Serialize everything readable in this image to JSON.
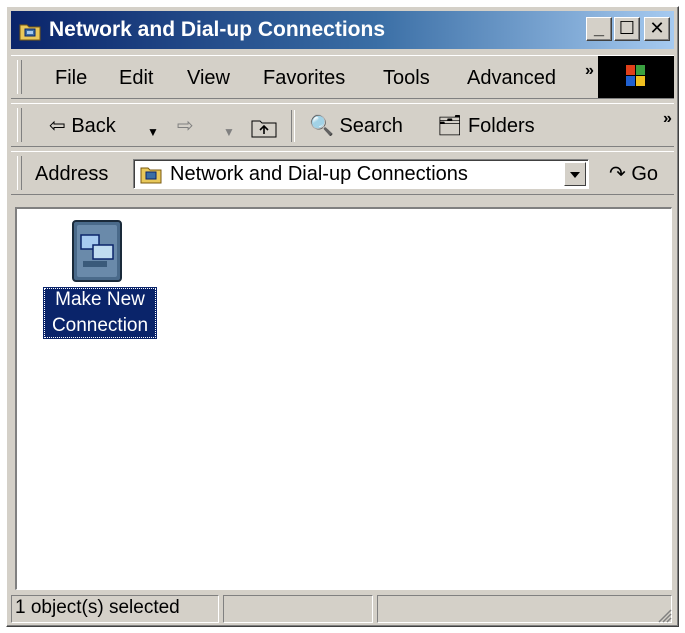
{
  "window": {
    "title": "Network and Dial-up Connections"
  },
  "title_buttons": {
    "minimize": "_",
    "maximize": "☐",
    "close": "✕"
  },
  "menu": {
    "items": [
      "File",
      "Edit",
      "View",
      "Favorites",
      "Tools",
      "Advanced"
    ],
    "overflow": "»"
  },
  "toolbar": {
    "back_label": "Back",
    "search_label": "Search",
    "folders_label": "Folders",
    "overflow": "»"
  },
  "address": {
    "label": "Address",
    "value": "Network and Dial-up Connections",
    "go_label": "Go"
  },
  "content": {
    "items": [
      {
        "label": "Make New Connection",
        "selected": true
      }
    ]
  },
  "statusbar": {
    "text": "1 object(s) selected"
  },
  "colors": {
    "title_start": "#0a246a",
    "title_end": "#a6caf0",
    "chrome": "#d4d0c8",
    "selection": "#0a246a"
  }
}
